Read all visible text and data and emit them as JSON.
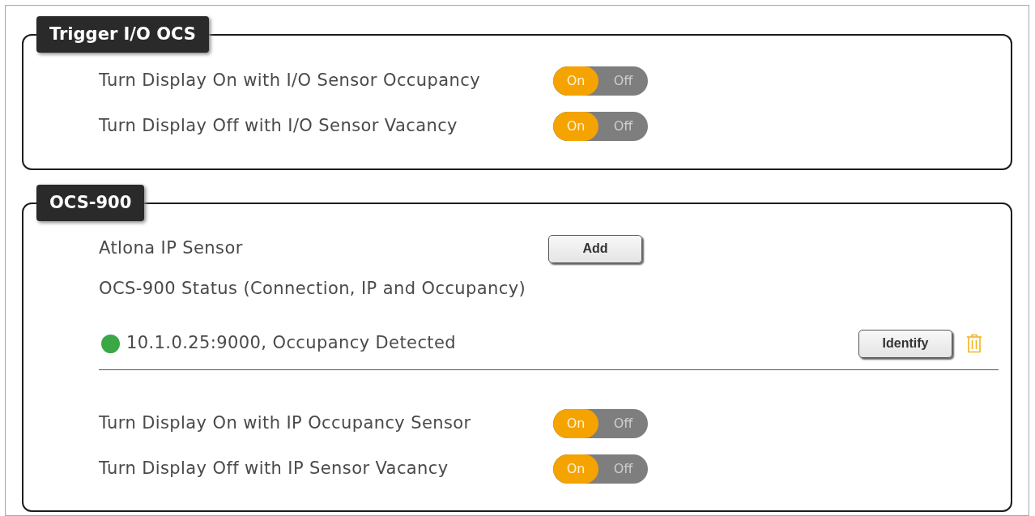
{
  "sections": [
    {
      "title": "Trigger I/O OCS",
      "rows": [
        {
          "kind": "toggle",
          "label": "Turn Display On with I/O Sensor Occupancy",
          "on": true,
          "on_label": "On",
          "off_label": "Off"
        },
        {
          "kind": "toggle",
          "label": "Turn Display Off with I/O Sensor Vacancy",
          "on": true,
          "on_label": "On",
          "off_label": "Off"
        }
      ]
    },
    {
      "title": "OCS-900",
      "rows": [
        {
          "kind": "button",
          "label": "Atlona IP Sensor",
          "button": "Add"
        },
        {
          "kind": "text",
          "label": "OCS-900 Status (Connection, IP and Occupancy)"
        },
        {
          "kind": "sensor",
          "text": "10.1.0.25:9000, Occupancy Detected",
          "color": "#3aa845",
          "button": "Identify"
        },
        {
          "kind": "toggle",
          "label": "Turn Display On with IP Occupancy Sensor",
          "on": true,
          "on_label": "On",
          "off_label": "Off"
        },
        {
          "kind": "toggle",
          "label": "Turn Display Off with IP Sensor Vacancy",
          "on": true,
          "on_label": "On",
          "off_label": "Off"
        }
      ]
    }
  ]
}
